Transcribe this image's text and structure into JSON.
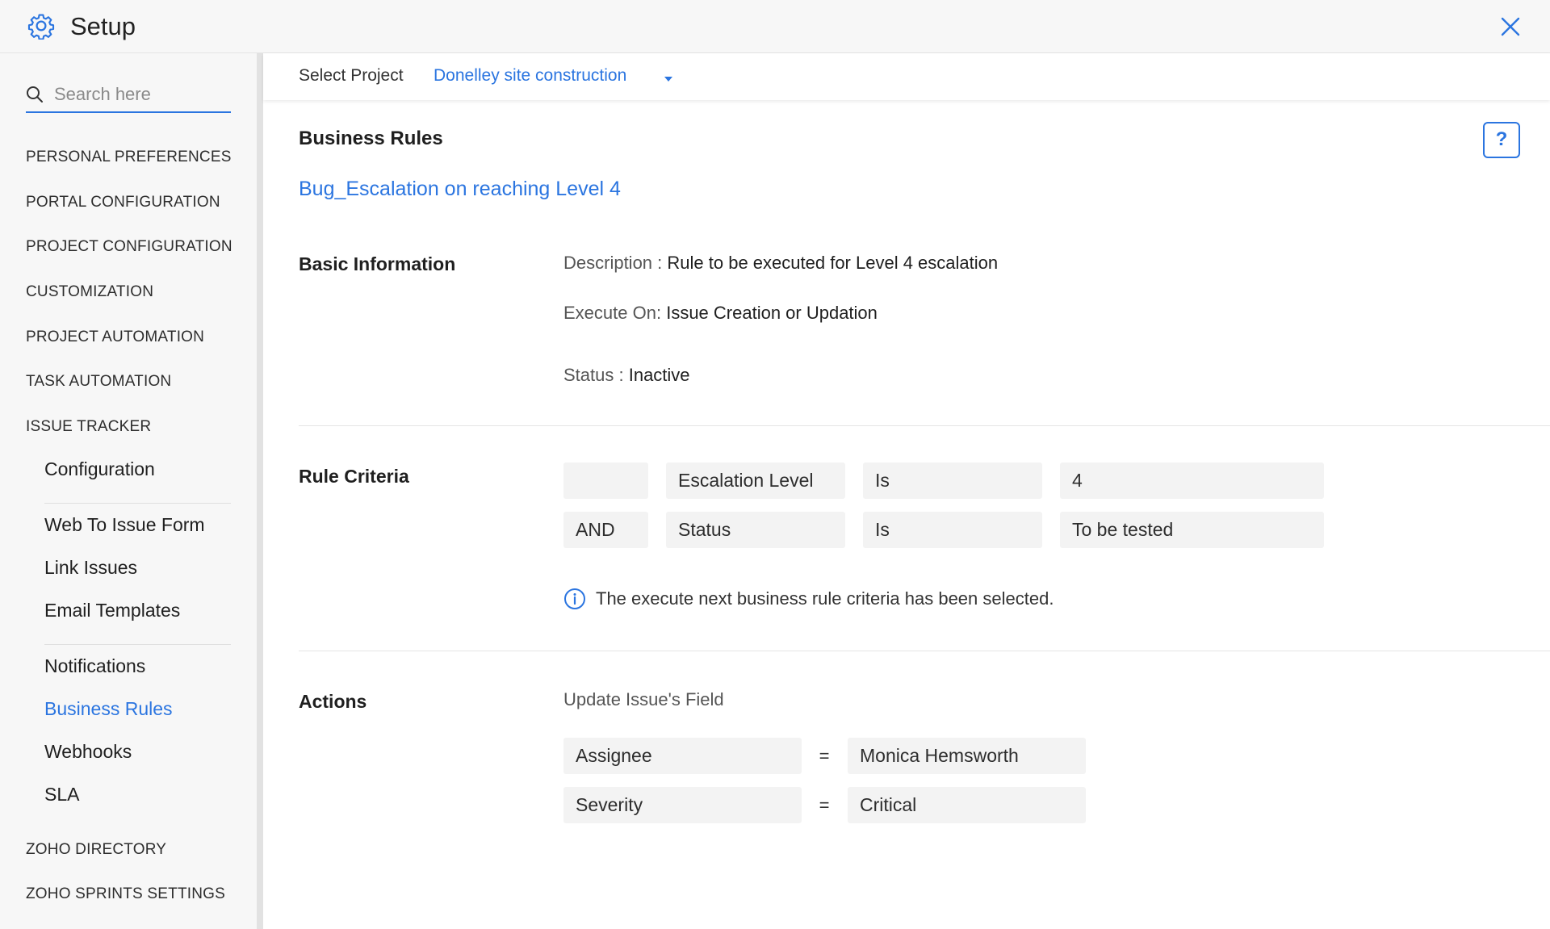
{
  "header": {
    "title": "Setup",
    "accent_color": "#2b75e0"
  },
  "sidebar": {
    "search": {
      "placeholder": "Search here",
      "value": ""
    },
    "sections": [
      "PERSONAL PREFERENCES",
      "PORTAL CONFIGURATION",
      "PROJECT CONFIGURATION",
      "CUSTOMIZATION",
      "PROJECT AUTOMATION",
      "TASK AUTOMATION",
      "ISSUE TRACKER"
    ],
    "issue_tracker_items": [
      "Configuration",
      "Web To Issue Form",
      "Link Issues",
      "Email Templates",
      "Notifications",
      "Business Rules",
      "Webhooks",
      "SLA"
    ],
    "active_item": "Business Rules",
    "bottom_sections": [
      "ZOHO DIRECTORY",
      "ZOHO SPRINTS SETTINGS"
    ]
  },
  "project_bar": {
    "label": "Select Project",
    "selected_project": "Donelley site construction"
  },
  "main": {
    "page_title": "Business Rules",
    "help_label": "?",
    "rule_name": "Bug_Escalation on reaching Level 4",
    "basic_info": {
      "label": "Basic Information",
      "description_label": "Description :",
      "description_value": "Rule to be executed for Level 4 escalation",
      "execute_on_label": "Execute On:",
      "execute_on_value": "Issue Creation or Updation",
      "status_label": "Status :",
      "status_value": "Inactive"
    },
    "rule_criteria": {
      "label": "Rule Criteria",
      "rows": [
        {
          "operator": "",
          "field": "Escalation Level",
          "condition": "Is",
          "value": "4"
        },
        {
          "operator": "AND",
          "field": "Status",
          "condition": "Is",
          "value": "To be tested"
        }
      ],
      "note": "The execute next business rule criteria has been selected."
    },
    "actions": {
      "label": "Actions",
      "title": "Update Issue's Field",
      "rows": [
        {
          "field": "Assignee",
          "eq": "=",
          "value": "Monica Hemsworth"
        },
        {
          "field": "Severity",
          "eq": "=",
          "value": "Critical"
        }
      ]
    }
  }
}
